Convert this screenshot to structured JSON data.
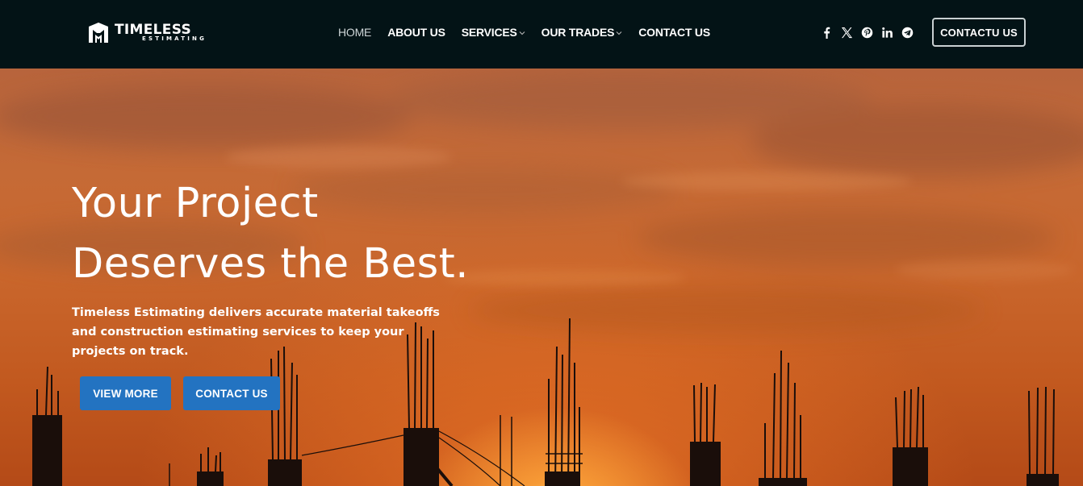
{
  "brand": {
    "name": "TIMELESS",
    "tagline": "ESTIMATING"
  },
  "nav": {
    "items": [
      {
        "label": "HOME",
        "active": true,
        "dropdown": false
      },
      {
        "label": "ABOUT US",
        "active": false,
        "dropdown": false
      },
      {
        "label": "SERVICES",
        "active": false,
        "dropdown": true
      },
      {
        "label": "OUR TRADES",
        "active": false,
        "dropdown": true
      },
      {
        "label": "CONTACT US",
        "active": false,
        "dropdown": false
      }
    ]
  },
  "socials": [
    "facebook-icon",
    "x-twitter-icon",
    "pinterest-icon",
    "linkedin-icon",
    "telegram-icon"
  ],
  "header": {
    "cta_label": "CONTACTU US"
  },
  "hero": {
    "title_line1": "Your Project",
    "title_line2": "Deserves the Best.",
    "subtitle": "Timeless Estimating delivers accurate material takeoffs and construction estimating services to keep your projects on track.",
    "primary_button": "VIEW MORE",
    "secondary_button": "CONTACT US"
  },
  "colors": {
    "header_bg": "#031316",
    "button_blue": "#2373c1",
    "sky_orange": "#c9662c",
    "text_white": "#ffffff"
  }
}
